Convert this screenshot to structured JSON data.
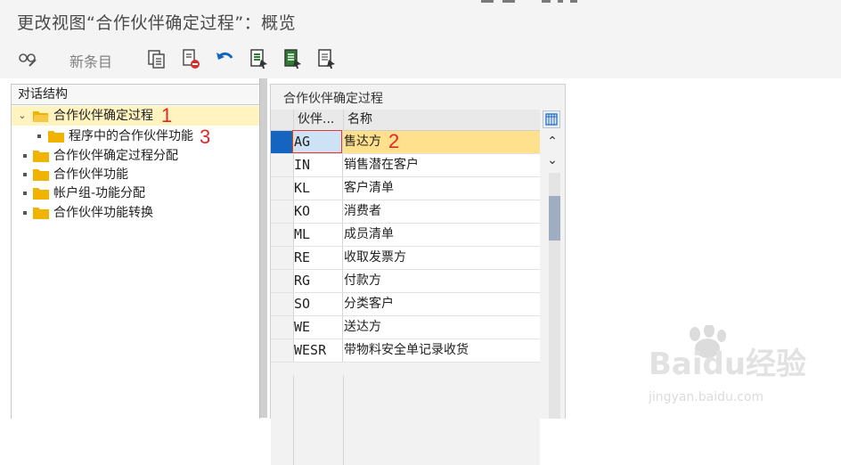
{
  "window": {
    "title": "更改视图“合作伙伴确定过程”：概览"
  },
  "toolbar": {
    "new_entries_label": "新条目",
    "icons": [
      "glasses-pencil-icon",
      "copy-icon",
      "delete-icon",
      "undo-icon",
      "select-all-icon",
      "select-block-icon",
      "deselect-all-icon"
    ]
  },
  "left_panel": {
    "header": "对话结构",
    "tree": [
      {
        "label": "合作伙伴确定过程",
        "expanded": true,
        "selected": true,
        "folder_open": true,
        "annotation": "1"
      },
      {
        "label": "程序中的合作伙伴功能",
        "indent": 1,
        "annotation": "3"
      },
      {
        "label": "合作伙伴确定过程分配"
      },
      {
        "label": "合作伙伴功能"
      },
      {
        "label": "帐户组-功能分配"
      },
      {
        "label": "合作伙伴功能转换"
      }
    ]
  },
  "right_panel": {
    "title": "合作伙伴确定过程",
    "columns": {
      "code": "伙伴...",
      "name": "名称"
    },
    "rows": [
      {
        "code": "AG",
        "name": "售达方",
        "active": true,
        "annotation": "2"
      },
      {
        "code": "IN",
        "name": "销售潜在客户"
      },
      {
        "code": "KL",
        "name": "客户清单"
      },
      {
        "code": "KO",
        "name": "消费者"
      },
      {
        "code": "ML",
        "name": "成员清单"
      },
      {
        "code": "RE",
        "name": "收取发票方"
      },
      {
        "code": "RG",
        "name": "付款方"
      },
      {
        "code": "SO",
        "name": "分类客户"
      },
      {
        "code": "WE",
        "name": "送达方"
      },
      {
        "code": "WESR",
        "name": "带物料安全单记录收货"
      }
    ]
  },
  "watermark": {
    "brand": "Baidu经验",
    "url": "jingyan.baidu.com"
  },
  "colors": {
    "selection_row": "#ffe08c",
    "tree_selected": "#fff4c0",
    "annotation_red": "#e0262a",
    "folder": "#f0b400",
    "row_marker": "#1565c0"
  }
}
